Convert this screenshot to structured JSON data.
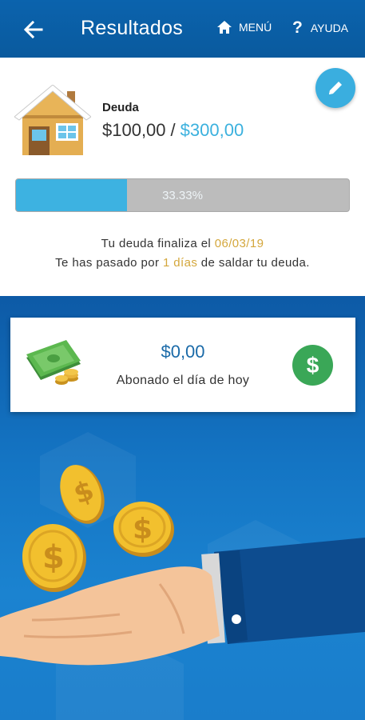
{
  "header": {
    "title": "Resultados",
    "menu_label": "MENÚ",
    "help_label": "AYUDA"
  },
  "debt": {
    "label": "Deuda",
    "paid": "$100,00",
    "separator": "/",
    "total": "$300,00",
    "progress_text": "33.33%",
    "progress_fraction": 0.3333
  },
  "info": {
    "line1_prefix": "Tu deuda finaliza el ",
    "end_date": "06/03/19",
    "line2_prefix": "Te has pasado por ",
    "days_over": "1 días",
    "line2_suffix": " de saldar tu deuda."
  },
  "today": {
    "amount": "$0,00",
    "caption": "Abonado el día de hoy"
  },
  "icons": {
    "back": "arrow-left-icon",
    "home": "home-icon",
    "help": "question-icon",
    "edit": "pencil-icon",
    "house": "house-icon",
    "cash": "cash-icon",
    "dollar": "dollar-icon"
  },
  "colors": {
    "appbar": "#0b63ad",
    "accent": "#3aaedf",
    "gold": "#d4a73c",
    "green": "#3aa757"
  }
}
